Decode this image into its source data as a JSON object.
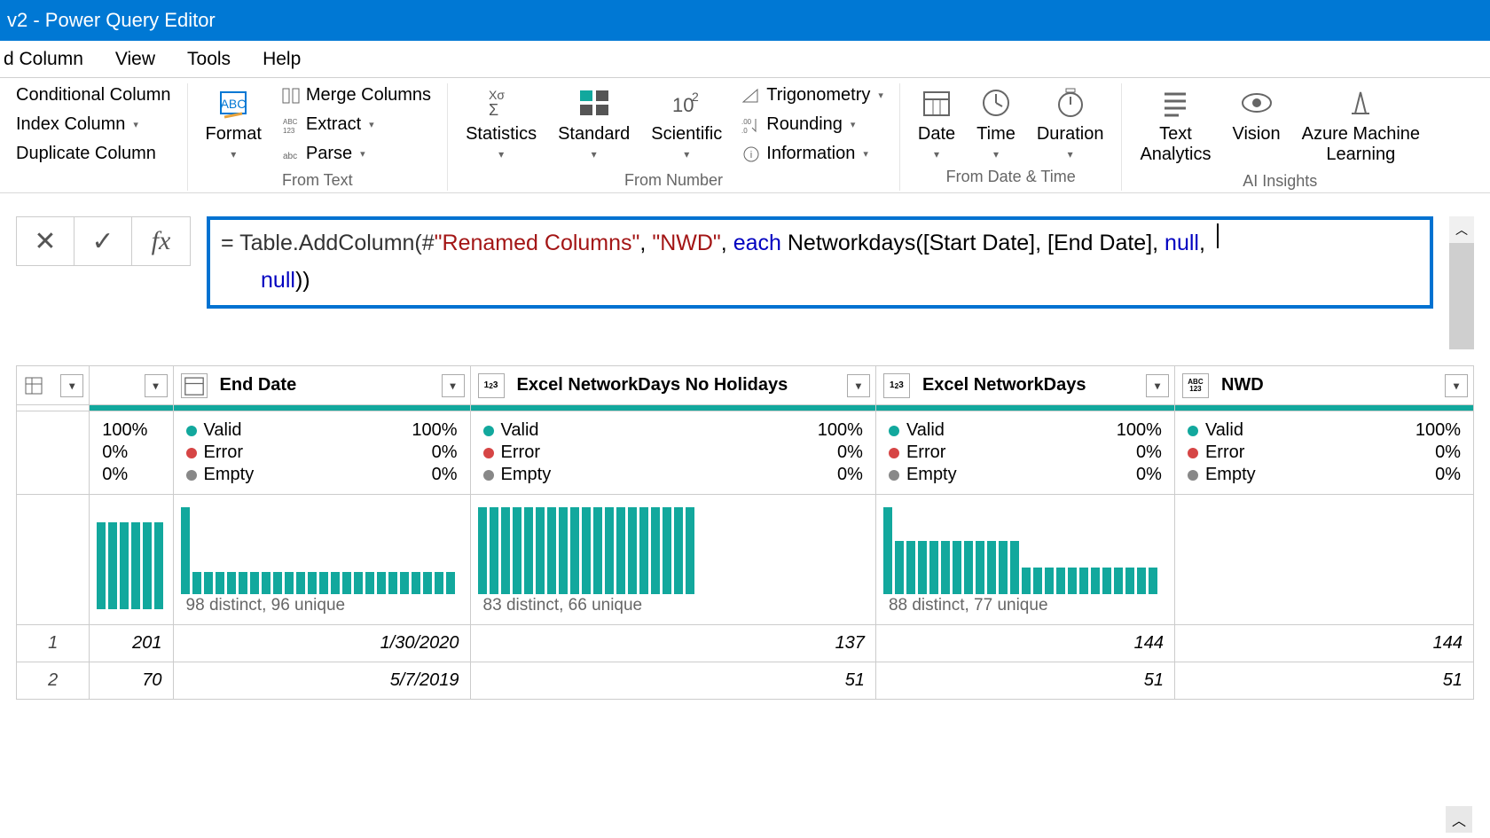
{
  "title": "v2 - Power Query Editor",
  "menu": {
    "addcol": "d Column",
    "view": "View",
    "tools": "Tools",
    "help": "Help"
  },
  "ribbon": {
    "conditional": "Conditional Column",
    "index": "Index Column",
    "duplicate": "Duplicate Column",
    "format": "Format",
    "merge": "Merge Columns",
    "extract": "Extract",
    "parse": "Parse",
    "fromtext": "From Text",
    "stats": "Statistics",
    "standard": "Standard",
    "scientific": "Scientific",
    "trig": "Trigonometry",
    "round": "Rounding",
    "info": "Information",
    "fromnumber": "From Number",
    "date": "Date",
    "time": "Time",
    "duration": "Duration",
    "fromdate": "From Date & Time",
    "textan": "Text\nAnalytics",
    "vision": "Vision",
    "aml": "Azure Machine\nLearning",
    "aiinsights": "AI Insights"
  },
  "formula": {
    "prefix": "= Table.AddColumn(#",
    "renamed": "\"Renamed Columns\"",
    "comma1": ", ",
    "nwd": "\"NWD\"",
    "comma2": ", ",
    "each": "each",
    "mid": " Networkdays([Start Date], [End Date], ",
    "null1": "null",
    "comma3": ", ",
    "null2": "null",
    "end": "))"
  },
  "columns": {
    "c0": {
      "name": "",
      "valid": "100%",
      "err": "0%",
      "emp": "0%"
    },
    "c1": {
      "name": "End Date",
      "valid": "Valid",
      "validp": "100%",
      "err": "Error",
      "errp": "0%",
      "emp": "Empty",
      "empp": "0%",
      "dist": "98 distinct, 96 unique"
    },
    "c2": {
      "name": "Excel NetworkDays No Holidays",
      "valid": "Valid",
      "validp": "100%",
      "err": "Error",
      "errp": "0%",
      "emp": "Empty",
      "empp": "0%",
      "dist": "83 distinct, 66 unique"
    },
    "c3": {
      "name": "Excel NetworkDays",
      "valid": "Valid",
      "validp": "100%",
      "err": "Error",
      "errp": "0%",
      "emp": "Empty",
      "empp": "0%",
      "dist": "88 distinct, 77 unique"
    },
    "c4": {
      "name": "NWD",
      "valid": "Valid",
      "validp": "100%",
      "err": "Error",
      "errp": "0%",
      "emp": "Empty",
      "empp": "0%"
    }
  },
  "rows": [
    {
      "n": "1",
      "c0": "201",
      "c1": "1/30/2020",
      "c2": "137",
      "c3": "144",
      "c4": "144"
    },
    {
      "n": "2",
      "c0": "70",
      "c1": "5/7/2019",
      "c2": "51",
      "c3": "51",
      "c4": "51"
    }
  ],
  "chart_data": {
    "type": "bar",
    "note": "column profile sparkline bar heights (relative 0-100)",
    "c0": [
      98,
      98,
      98,
      98,
      98,
      98
    ],
    "c1": [
      98,
      25,
      25,
      25,
      25,
      25,
      25,
      25,
      25,
      25,
      25,
      25,
      25,
      25,
      25,
      25,
      25,
      25,
      25,
      25,
      25,
      25,
      25,
      25
    ],
    "c2": [
      98,
      98,
      98,
      98,
      98,
      98,
      98,
      98,
      98,
      98,
      98,
      98,
      98,
      98,
      98,
      98,
      98,
      98,
      98
    ],
    "c3": [
      98,
      60,
      60,
      60,
      60,
      60,
      60,
      60,
      60,
      60,
      60,
      60,
      30,
      30,
      30,
      30,
      30,
      30,
      30,
      30,
      30,
      30,
      30,
      30
    ]
  }
}
